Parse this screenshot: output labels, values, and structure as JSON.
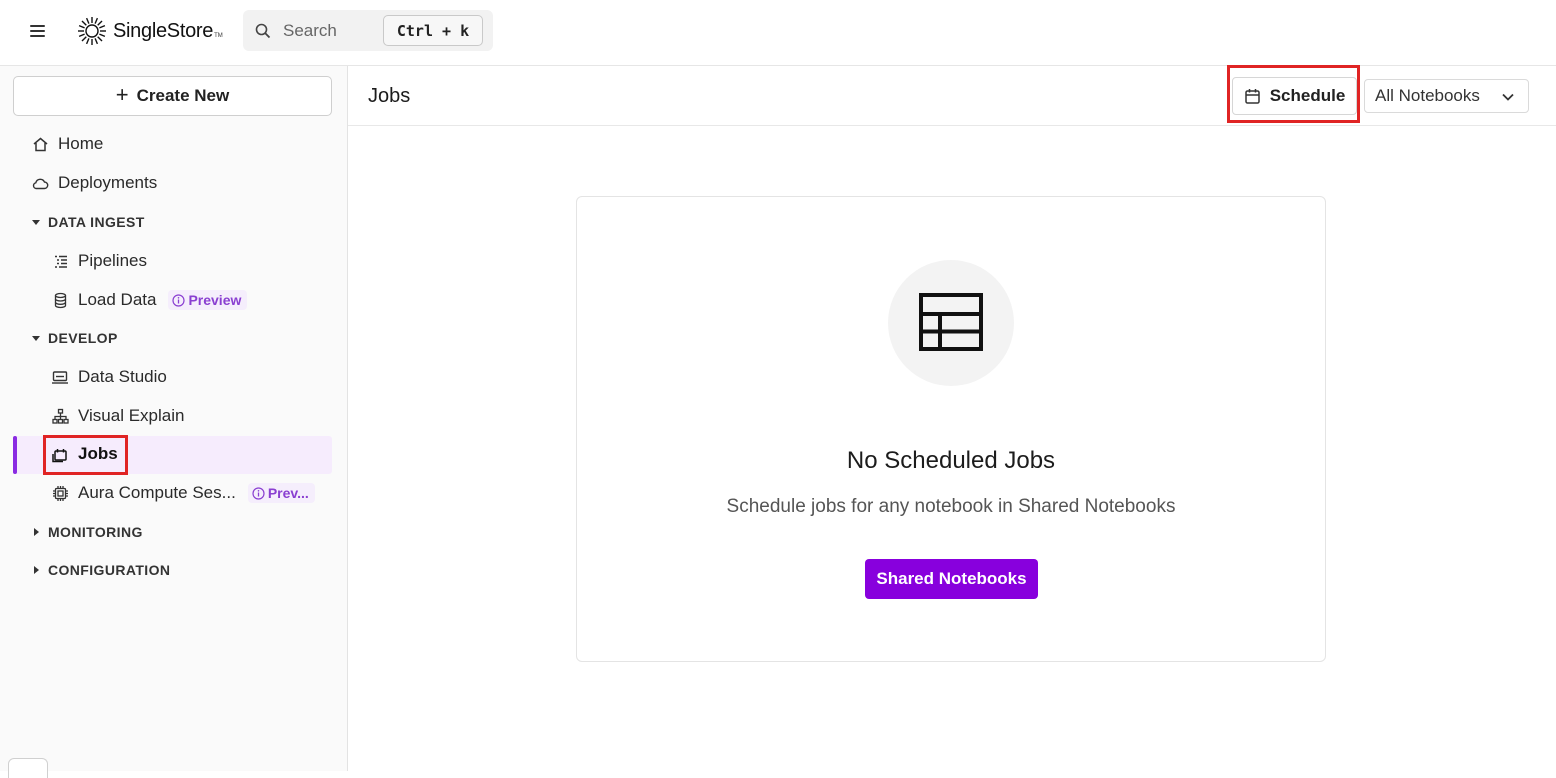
{
  "topbar": {
    "brand_name": "SingleStore",
    "brand_tm": "TM",
    "search_placeholder": "Search",
    "search_shortcut": "Ctrl + k"
  },
  "sidebar": {
    "create_new_label": "Create New",
    "items": {
      "home": "Home",
      "deployments": "Deployments",
      "pipelines": "Pipelines",
      "load_data": "Load Data",
      "load_data_badge": "Preview",
      "data_studio": "Data Studio",
      "visual_explain": "Visual Explain",
      "jobs": "Jobs",
      "aura": "Aura Compute Ses...",
      "aura_badge": "Prev..."
    },
    "sections": {
      "data_ingest": "DATA INGEST",
      "develop": "DEVELOP",
      "monitoring": "MONITORING",
      "configuration": "CONFIGURATION"
    },
    "active_item": "jobs"
  },
  "main": {
    "title": "Jobs",
    "schedule_label": "Schedule",
    "filter_selected": "All Notebooks",
    "empty_state": {
      "title": "No Scheduled Jobs",
      "subtitle": "Schedule jobs for any notebook in Shared Notebooks",
      "button_label": "Shared Notebooks"
    }
  },
  "colors": {
    "accent": "#8800dd",
    "highlight": "#e02424",
    "preview_badge": "#8a3fd1"
  }
}
